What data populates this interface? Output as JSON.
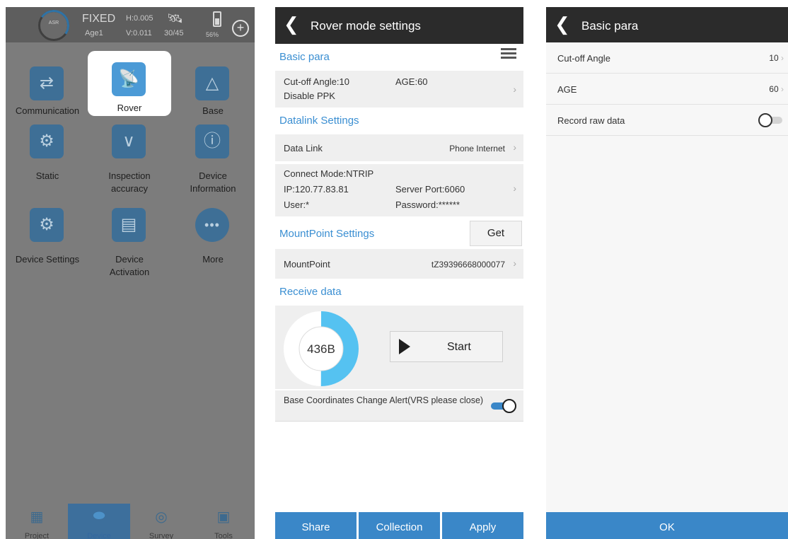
{
  "status": {
    "gauge_label": "ASR",
    "fix": "FIXED",
    "age": "Age1",
    "h": "H:0.005",
    "v": "V:0.011",
    "satellites": "30/45",
    "battery": "56%"
  },
  "device_grid": [
    {
      "label": "Communication",
      "icon": "communication-icon"
    },
    {
      "label": "Rover",
      "icon": "rover-icon"
    },
    {
      "label": "Base",
      "icon": "base-icon"
    },
    {
      "label": "Static",
      "icon": "static-icon"
    },
    {
      "label": "Inspection\naccuracy",
      "icon": "inspection-icon"
    },
    {
      "label": "Device\nInformation",
      "icon": "info-icon"
    },
    {
      "label": "Device Settings",
      "icon": "device-settings-icon"
    },
    {
      "label": "Device\nActivation",
      "icon": "activation-icon"
    },
    {
      "label": "More",
      "icon": "more-icon"
    }
  ],
  "tabs": [
    {
      "label": "Project",
      "icon": "project-icon"
    },
    {
      "label": "Device",
      "icon": "device-icon",
      "active": true
    },
    {
      "label": "Survey",
      "icon": "survey-icon"
    },
    {
      "label": "Tools",
      "icon": "tools-icon"
    }
  ],
  "rover": {
    "title": "Rover mode settings",
    "basic_para": {
      "header": "Basic para",
      "cutoff": "Cut-off Angle:10",
      "age": "AGE:60",
      "ppk": "Disable PPK"
    },
    "datalink": {
      "header": "Datalink Settings",
      "label": "Data Link",
      "value": "Phone Internet",
      "connect_mode": "Connect Mode:NTRIP",
      "ip": "IP:120.77.83.81",
      "port": "Server Port:6060",
      "user": "User:*",
      "password": "Password:******"
    },
    "mountpoint": {
      "header": "MountPoint Settings",
      "get": "Get",
      "label": "MountPoint",
      "value": "tZ39396668000077"
    },
    "receive": {
      "header": "Receive data",
      "amount": "436B",
      "start": "Start",
      "donut_fill": 0.5
    },
    "alert": {
      "text": "Base Coordinates Change Alert(VRS please close)",
      "on": true
    },
    "buttons": {
      "share": "Share",
      "collection": "Collection",
      "apply": "Apply"
    }
  },
  "basic_para_page": {
    "title": "Basic para",
    "rows": [
      {
        "label": "Cut-off Angle",
        "value": "10"
      },
      {
        "label": "AGE",
        "value": "60"
      },
      {
        "label": "Record raw data",
        "value": ""
      }
    ],
    "record_raw": false,
    "ok": "OK"
  },
  "colors": {
    "accent": "#3b8fd2",
    "button_blue": "#3a87c8",
    "dark_bar": "#2b2b2b",
    "overlay_gray": "#7c7c7c"
  }
}
